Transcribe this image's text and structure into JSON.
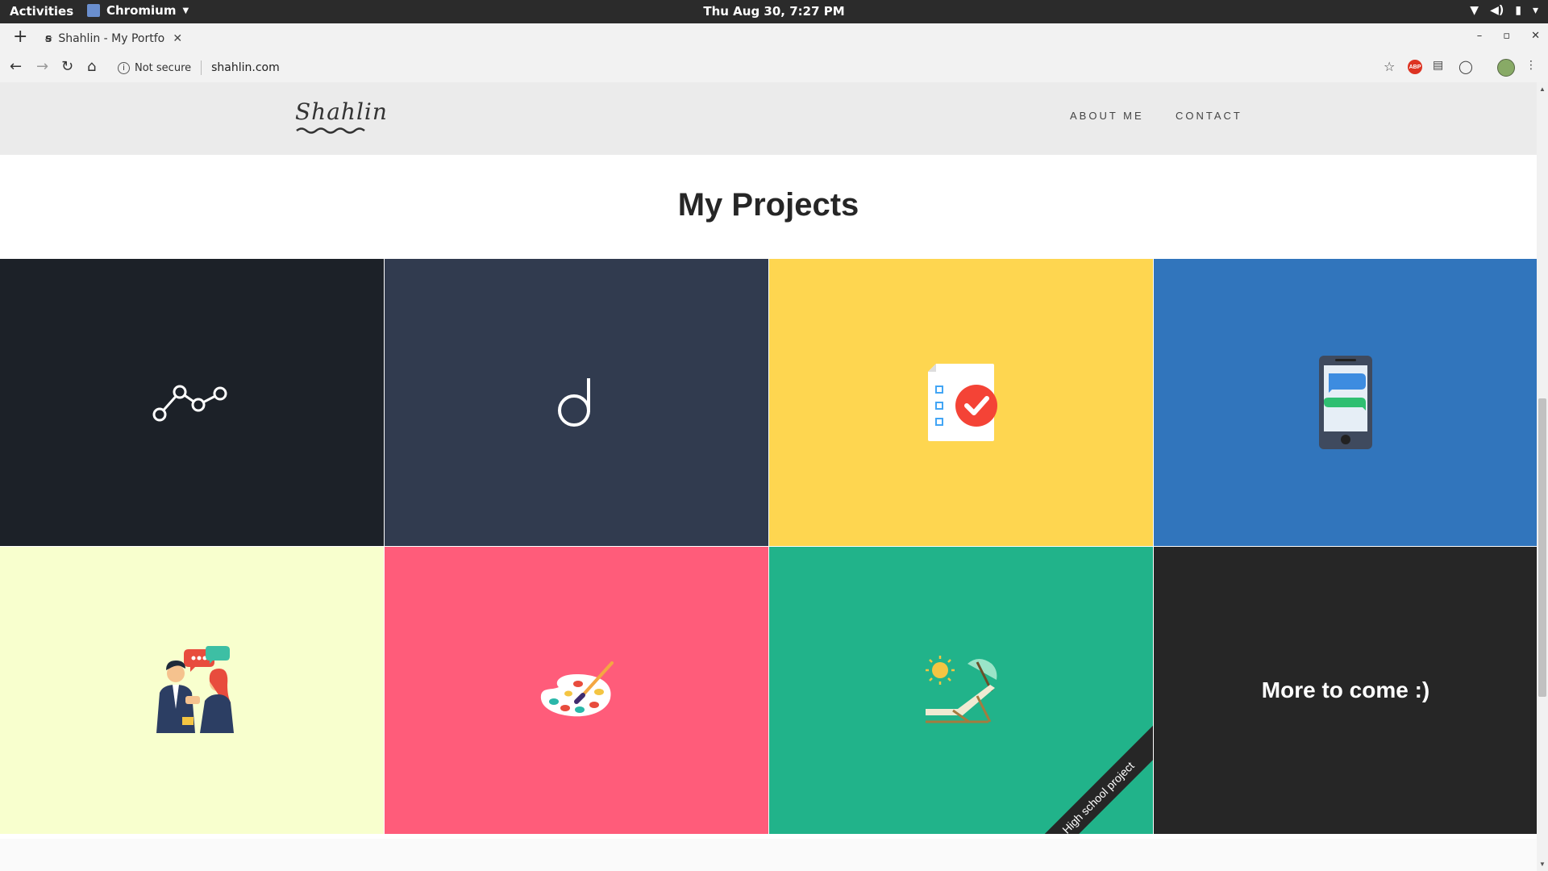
{
  "system_bar": {
    "activities": "Activities",
    "app_name": "Chromium",
    "clock": "Thu Aug 30,  7:27 PM"
  },
  "browser": {
    "tab_title": "Shahlin - My Portfo",
    "security_label": "Not secure",
    "url": "shahlin.com"
  },
  "site": {
    "logo": "Shahlin",
    "nav": [
      "ABOUT ME",
      "CONTACT"
    ],
    "heading": "My Projects",
    "projects": [
      {
        "icon": "line-graph-icon",
        "bg": "#1c2128"
      },
      {
        "icon": "letter-d-icon",
        "bg": "#313b4f"
      },
      {
        "icon": "checklist-icon",
        "bg": "#fed650"
      },
      {
        "icon": "chat-phone-icon",
        "bg": "#3175bc"
      },
      {
        "icon": "business-people-icon",
        "bg": "#f8ffce"
      },
      {
        "icon": "paint-palette-icon",
        "bg": "#ff5c7a"
      },
      {
        "icon": "beach-chair-icon",
        "bg": "#21b38a",
        "ribbon": "High school project"
      },
      {
        "text": "More to come :)",
        "bg": "#262626"
      }
    ]
  }
}
